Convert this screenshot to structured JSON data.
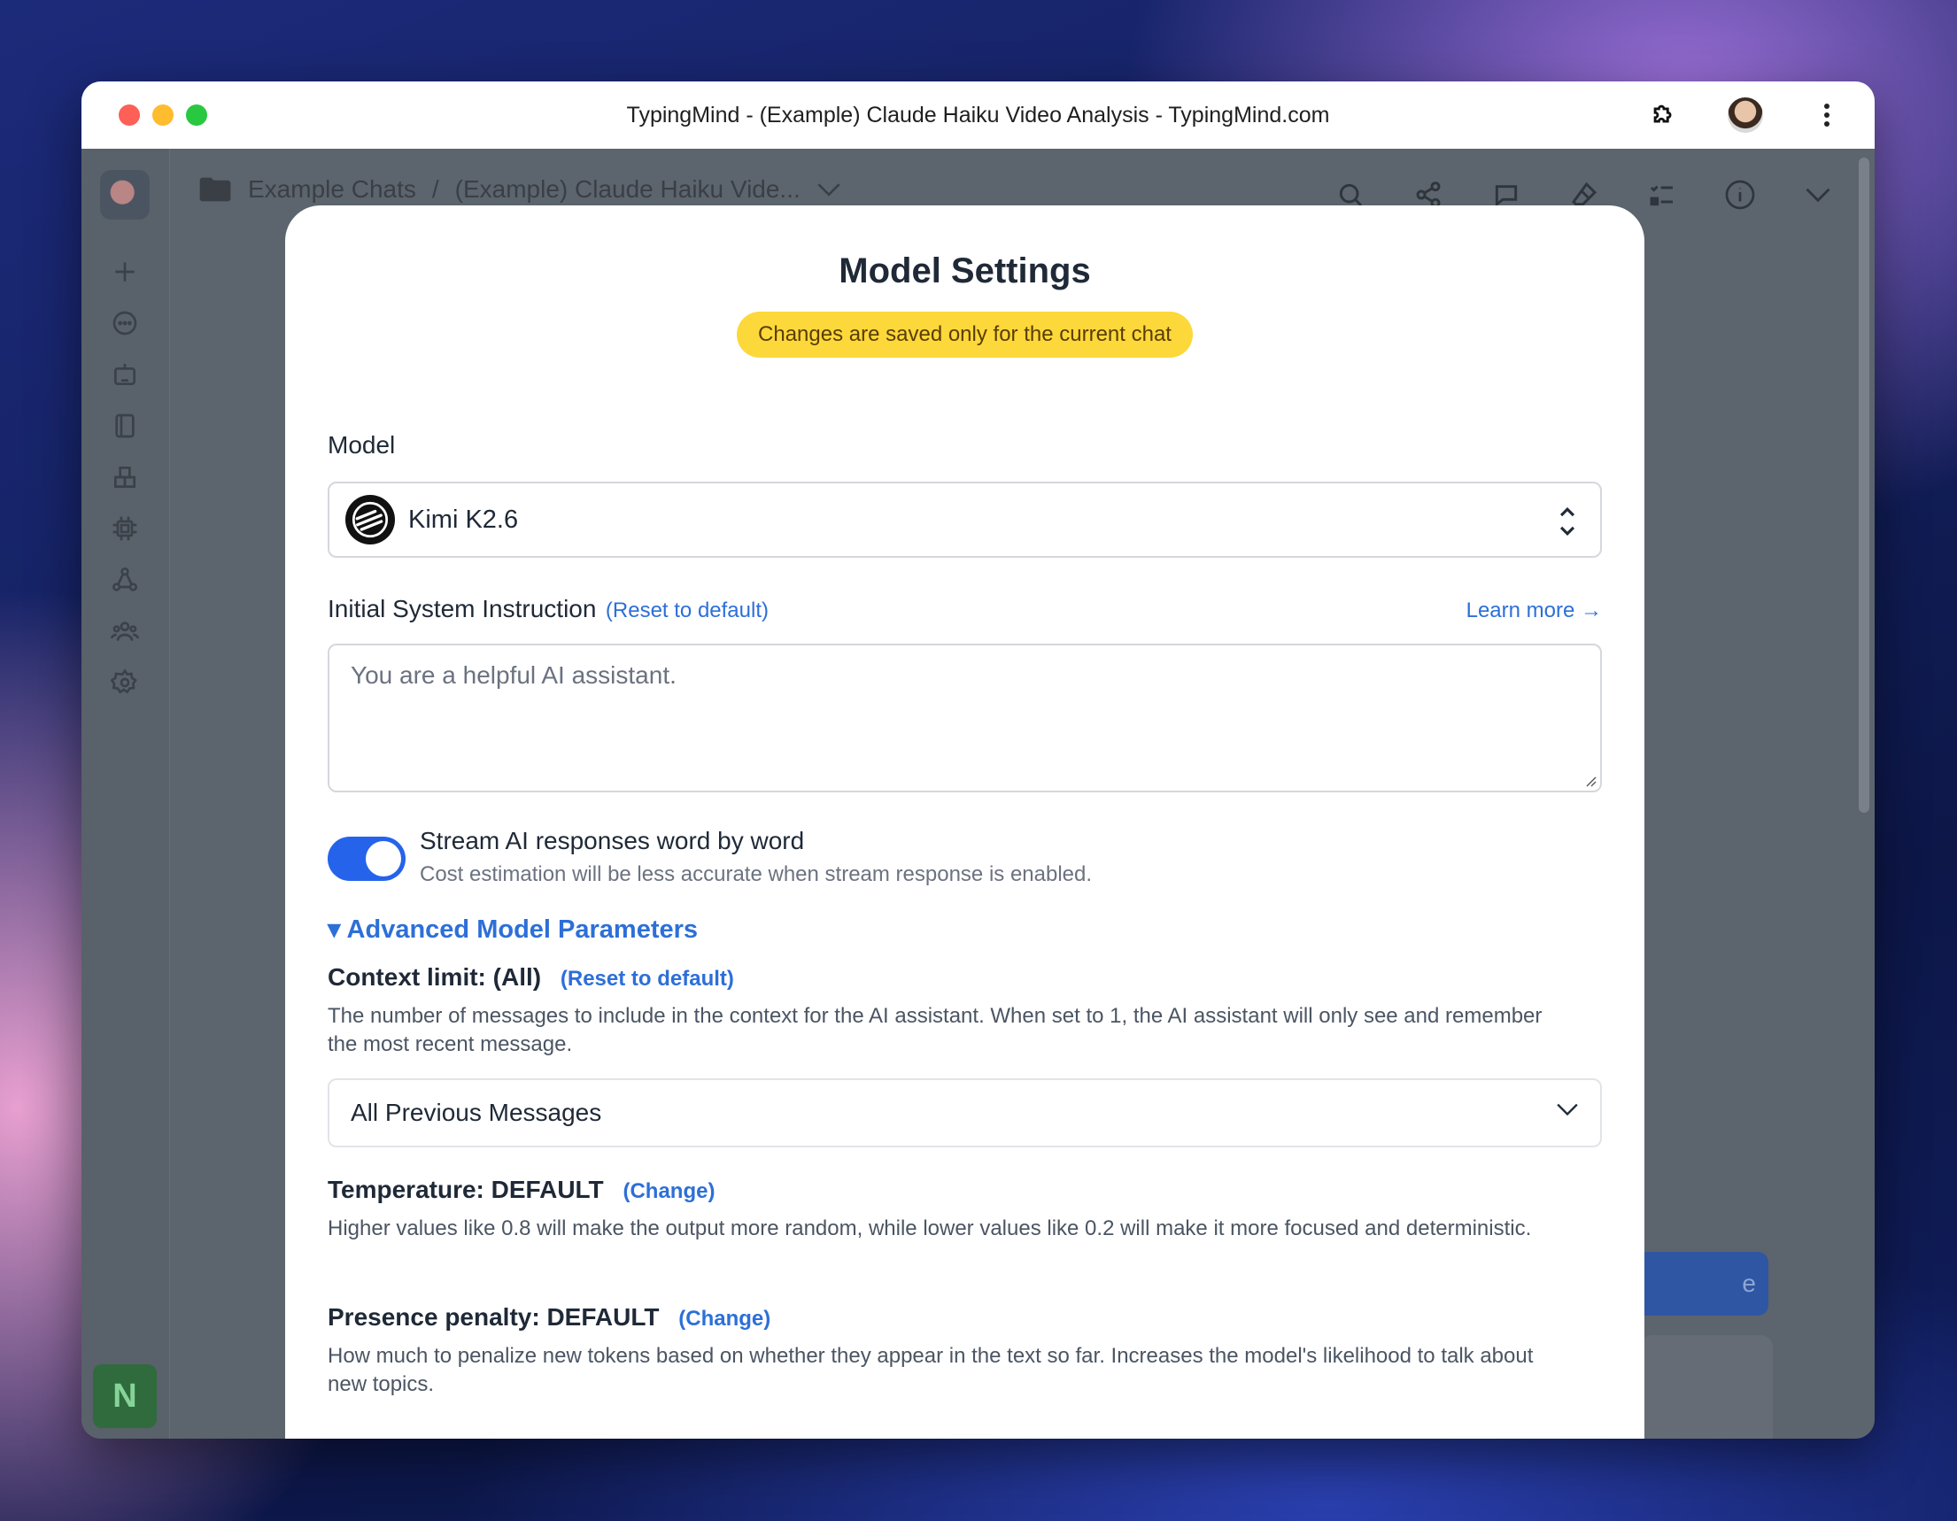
{
  "window": {
    "title": "TypingMind - (Example) Claude Haiku Video Analysis - TypingMind.com"
  },
  "app": {
    "breadcrumb": {
      "folder": "Example Chats",
      "separator": "/",
      "chat": "(Example) Claude Haiku Vide..."
    },
    "user_initial": "N",
    "background_button_fragment": "e"
  },
  "modal": {
    "title": "Model Settings",
    "notice": "Changes are saved only for the current chat",
    "model": {
      "label": "Model",
      "selected": "Kimi K2.6"
    },
    "system_instruction": {
      "label": "Initial System Instruction",
      "reset": "(Reset to default)",
      "learn_more": "Learn more →",
      "placeholder": "You are a helpful AI assistant."
    },
    "stream": {
      "enabled": true,
      "title": "Stream AI responses word by word",
      "subtitle": "Cost estimation will be less accurate when stream response is enabled."
    },
    "advanced": {
      "label": "▾ Advanced Model Parameters",
      "context": {
        "title": "Context limit: (All)",
        "reset": "(Reset to default)",
        "description": "The number of messages to include in the context for the AI assistant. When set to 1, the AI assistant will only see and remember the most recent message.",
        "selected": "All Previous Messages"
      },
      "temperature": {
        "title": "Temperature: DEFAULT",
        "change": "(Change)",
        "description": "Higher values like 0.8 will make the output more random, while lower values like 0.2 will make it more focused and deterministic."
      },
      "presence": {
        "title": "Presence penalty: DEFAULT",
        "change": "(Change)",
        "description": "How much to penalize new tokens based on whether they appear in the text so far. Increases the model's likelihood to talk about new topics."
      }
    }
  },
  "colors": {
    "accent": "#2d6fd8",
    "toggle": "#2563eb",
    "notice_bg": "#fcd83a"
  }
}
